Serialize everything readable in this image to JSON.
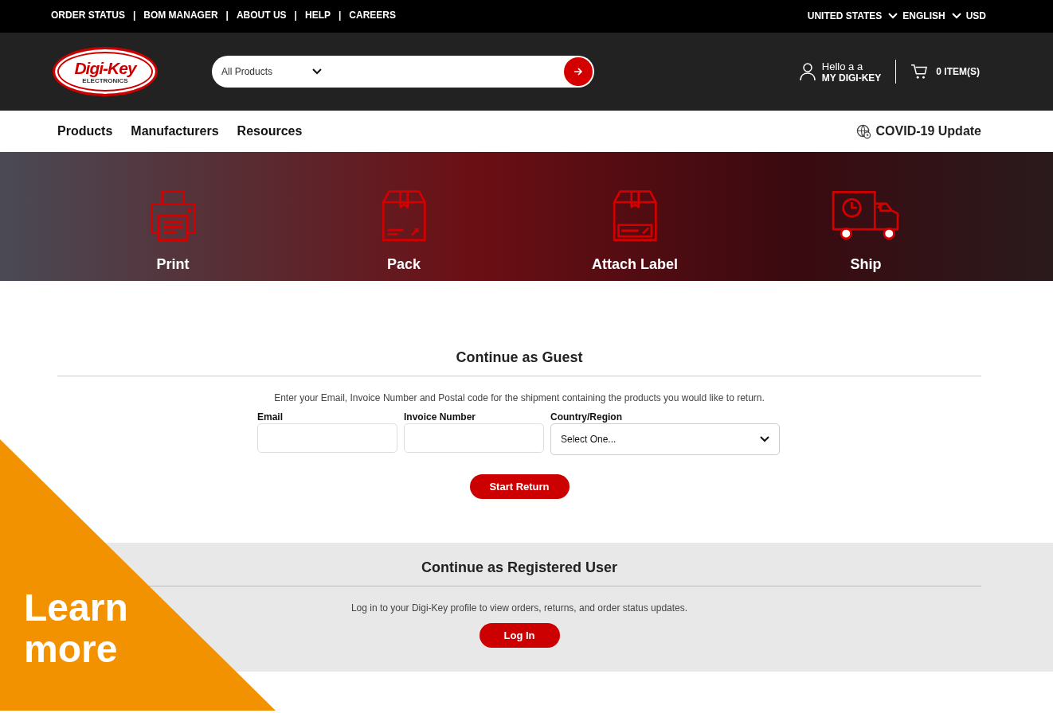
{
  "top_bar": {
    "links": [
      "ORDER STATUS",
      "BOM MANAGER",
      "ABOUT US",
      "HELP",
      "CAREERS"
    ],
    "separator": "|",
    "selectors": [
      {
        "label": "UNITED STATES",
        "dropdown": true
      },
      {
        "label": "ENGLISH",
        "dropdown": true
      },
      {
        "label": "USD",
        "dropdown": false
      }
    ]
  },
  "header": {
    "logo": {
      "name": "Digi-Key",
      "tagline": "ELECTRONICS"
    },
    "search": {
      "category": "All Products"
    },
    "account": {
      "greeting": "Hello a a",
      "label": "MY DIGI-KEY"
    },
    "cart": {
      "label": "0 ITEM(S)"
    }
  },
  "nav": {
    "items": [
      "Products",
      "Manufacturers",
      "Resources"
    ],
    "notice": "COVID-19 Update"
  },
  "steps": [
    {
      "kind": "print",
      "label": "Print"
    },
    {
      "kind": "pack",
      "label": "Pack"
    },
    {
      "kind": "label",
      "label": "Attach Label"
    },
    {
      "kind": "ship",
      "label": "Ship"
    }
  ],
  "guest": {
    "title": "Continue as Guest",
    "intro": "Enter your Email, Invoice Number and Postal code for the shipment containing the products you would like to return.",
    "fields": [
      {
        "kind": "text",
        "label": "Email"
      },
      {
        "kind": "text",
        "label": "Invoice Number"
      },
      {
        "kind": "select",
        "label": "Country/Region",
        "value": "Select One..."
      }
    ],
    "button": "Start Return"
  },
  "registered": {
    "title": "Continue as Registered User",
    "intro": "Log in to your Digi-Key profile to view orders, returns, and order status updates.",
    "button": "Log In"
  },
  "promo": {
    "text": "Learn more"
  }
}
